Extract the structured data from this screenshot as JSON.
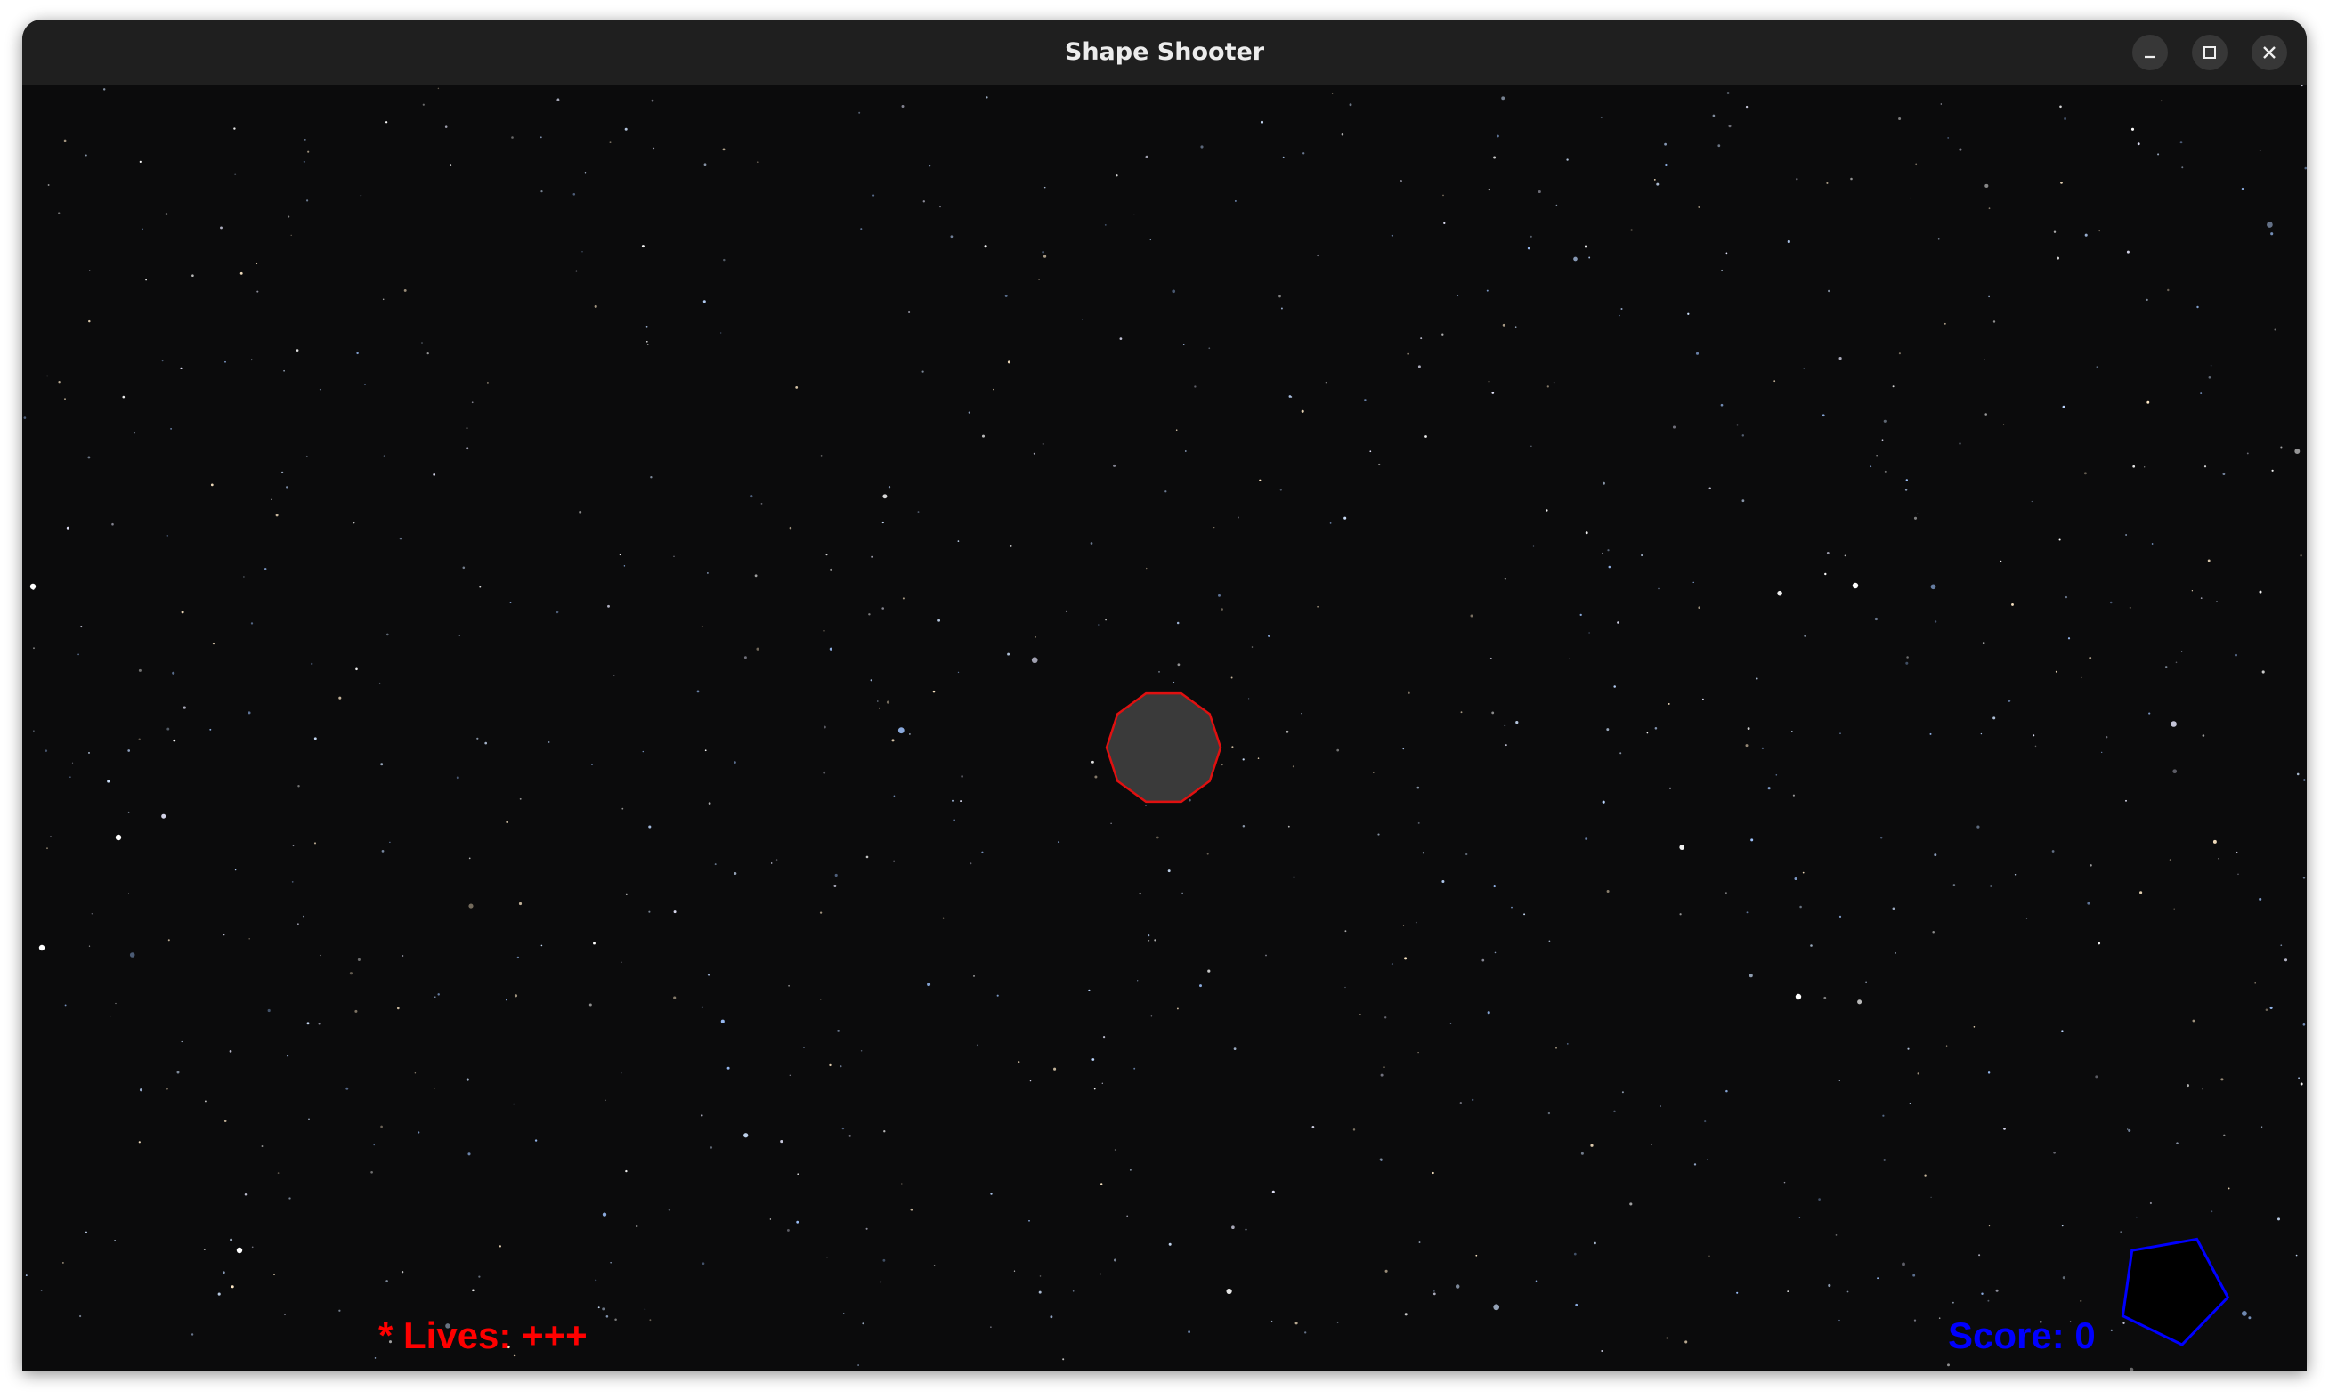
{
  "window": {
    "title": "Shape Shooter",
    "controls": [
      "minimize-icon",
      "maximize-icon",
      "close-icon"
    ]
  },
  "hud": {
    "lives_text": "* Lives: +++",
    "lives_count": 3,
    "score_text": "Score: 0",
    "score_value": 0
  },
  "game": {
    "background": "starfield",
    "player": {
      "shape": "decagon",
      "fill": "#3a3a3a",
      "stroke": "#e01010"
    },
    "enemy": {
      "shape": "pentagon",
      "fill": "#000000",
      "stroke": "#0000ff"
    }
  },
  "colors": {
    "lives": "#ff0000",
    "score": "#0000ff",
    "titlebar": "#1f1f1f",
    "space": "#0b0b0c"
  }
}
